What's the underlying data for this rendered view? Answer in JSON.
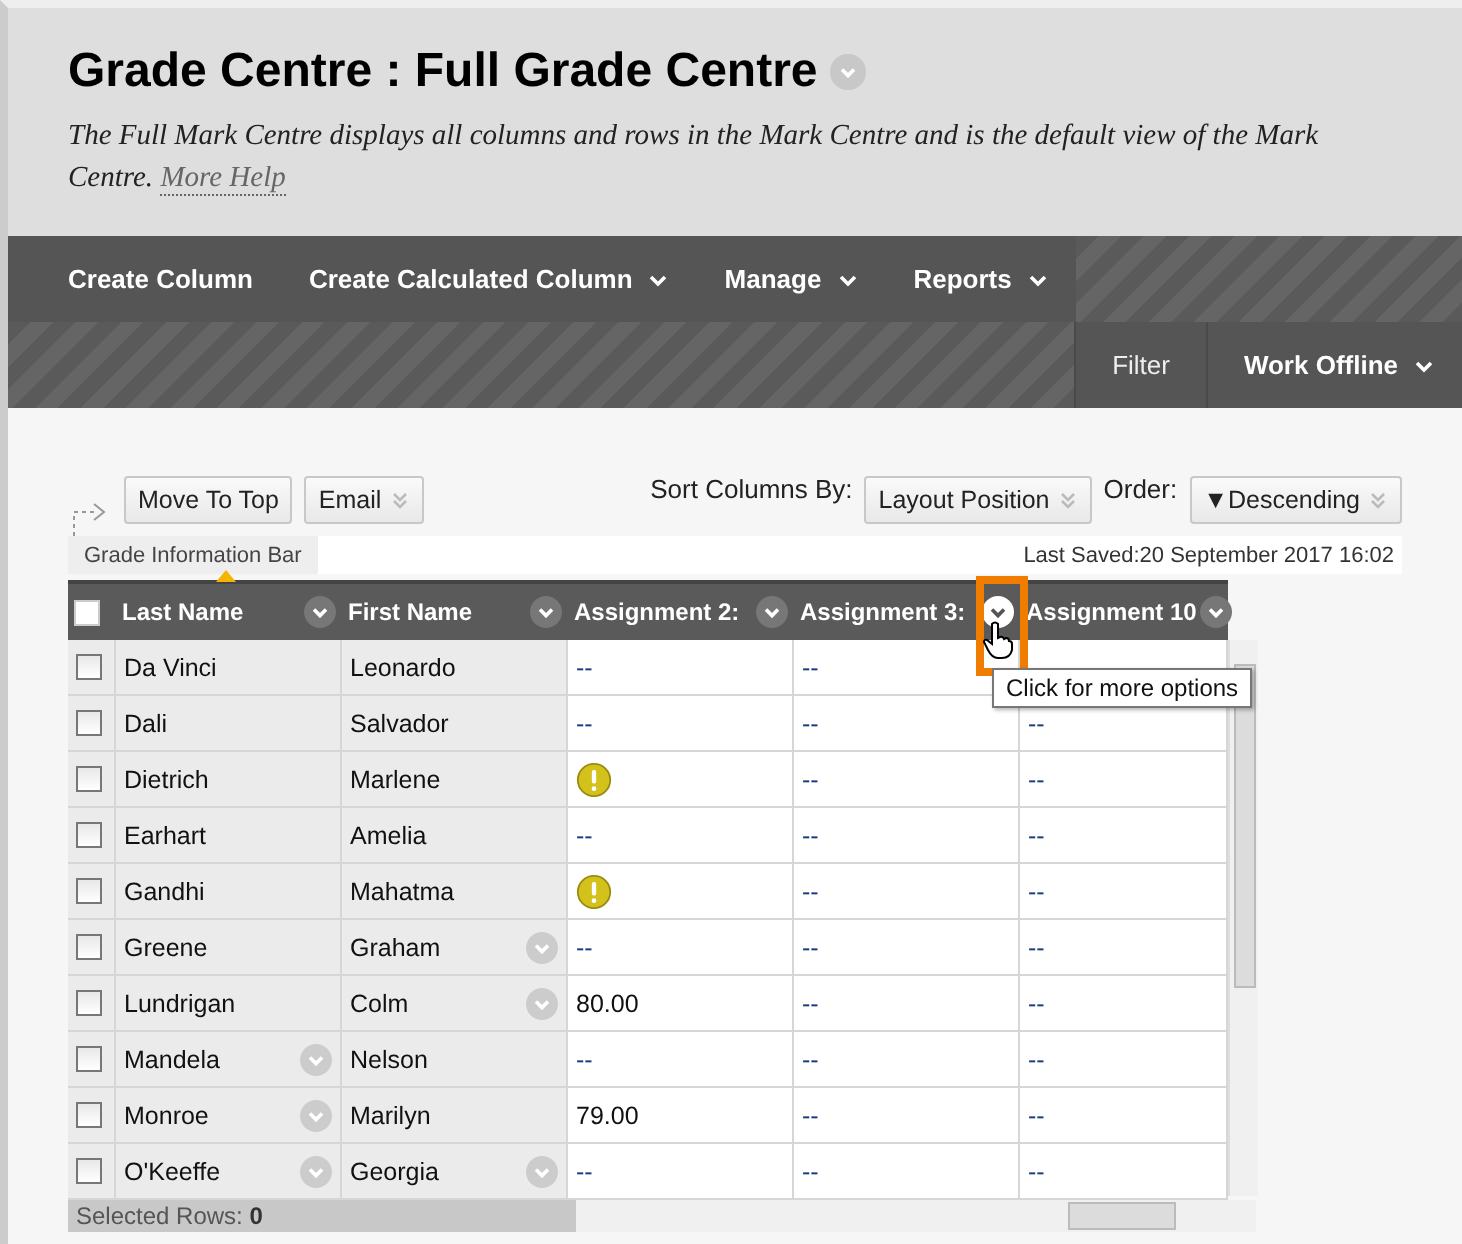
{
  "page": {
    "title": "Grade Centre : Full Grade Centre",
    "description": "The Full Mark Centre displays all columns and rows in the Mark Centre and is the default view of the Mark Centre.",
    "help_link": "More Help"
  },
  "action_bar": [
    {
      "label": "Create Column",
      "has_menu": false
    },
    {
      "label": "Create Calculated Column",
      "has_menu": true
    },
    {
      "label": "Manage",
      "has_menu": true
    },
    {
      "label": "Reports",
      "has_menu": true
    }
  ],
  "secondary_bar": [
    {
      "label": "Filter",
      "has_menu": false
    },
    {
      "label": "Work Offline",
      "has_menu": true
    }
  ],
  "controls": {
    "move_to_top": "Move To Top",
    "email": "Email",
    "sort_label": "Sort Columns By:",
    "sort_value": "Layout Position",
    "order_label": "Order:",
    "order_value": "▼Descending"
  },
  "info_bar": {
    "label": "Grade Information Bar",
    "last_saved": "Last Saved:20 September 2017 16:02"
  },
  "table": {
    "select_all_checked": false,
    "columns": [
      {
        "label": "Last Name",
        "highlighted": false
      },
      {
        "label": "First Name",
        "highlighted": false
      },
      {
        "label": "Assignment 2:",
        "highlighted": false
      },
      {
        "label": "Assignment 3:",
        "highlighted": true
      },
      {
        "label": "Assignment 10",
        "highlighted": false
      }
    ],
    "rows": [
      {
        "checked": false,
        "cells": [
          {
            "kind": "name",
            "value": "Da Vinci",
            "menu": false
          },
          {
            "kind": "name",
            "value": "Leonardo",
            "menu": false
          },
          {
            "kind": "text",
            "value": "--"
          },
          {
            "kind": "text",
            "value": "--"
          },
          {
            "kind": "blank"
          }
        ]
      },
      {
        "checked": false,
        "cells": [
          {
            "kind": "name",
            "value": "Dali",
            "menu": false
          },
          {
            "kind": "name",
            "value": "Salvador",
            "menu": false
          },
          {
            "kind": "text",
            "value": "--"
          },
          {
            "kind": "text",
            "value": "--"
          },
          {
            "kind": "text",
            "value": "--"
          }
        ]
      },
      {
        "checked": false,
        "cells": [
          {
            "kind": "name",
            "value": "Dietrich",
            "menu": false
          },
          {
            "kind": "name",
            "value": "Marlene",
            "menu": false
          },
          {
            "kind": "alert"
          },
          {
            "kind": "text",
            "value": "--"
          },
          {
            "kind": "text",
            "value": "--"
          }
        ]
      },
      {
        "checked": false,
        "cells": [
          {
            "kind": "name",
            "value": "Earhart",
            "menu": false
          },
          {
            "kind": "name",
            "value": "Amelia",
            "menu": false
          },
          {
            "kind": "text",
            "value": "--"
          },
          {
            "kind": "text",
            "value": "--"
          },
          {
            "kind": "text",
            "value": "--"
          }
        ]
      },
      {
        "checked": false,
        "cells": [
          {
            "kind": "name",
            "value": "Gandhi",
            "menu": false
          },
          {
            "kind": "name",
            "value": "Mahatma",
            "menu": false
          },
          {
            "kind": "alert"
          },
          {
            "kind": "text",
            "value": "--"
          },
          {
            "kind": "text",
            "value": "--"
          }
        ]
      },
      {
        "checked": false,
        "cells": [
          {
            "kind": "name",
            "value": "Greene",
            "menu": false
          },
          {
            "kind": "name",
            "value": "Graham",
            "menu": true
          },
          {
            "kind": "text",
            "value": "--"
          },
          {
            "kind": "text",
            "value": "--"
          },
          {
            "kind": "text",
            "value": "--"
          }
        ]
      },
      {
        "checked": false,
        "cells": [
          {
            "kind": "name",
            "value": "Lundrigan",
            "menu": false
          },
          {
            "kind": "name",
            "value": "Colm",
            "menu": true
          },
          {
            "kind": "text",
            "value": "80.00"
          },
          {
            "kind": "text",
            "value": "--"
          },
          {
            "kind": "text",
            "value": "--"
          }
        ]
      },
      {
        "checked": false,
        "cells": [
          {
            "kind": "name",
            "value": "Mandela",
            "menu": true
          },
          {
            "kind": "name",
            "value": "Nelson",
            "menu": false
          },
          {
            "kind": "text",
            "value": "--"
          },
          {
            "kind": "text",
            "value": "--"
          },
          {
            "kind": "text",
            "value": "--"
          }
        ]
      },
      {
        "checked": false,
        "cells": [
          {
            "kind": "name",
            "value": "Monroe",
            "menu": true
          },
          {
            "kind": "name",
            "value": "Marilyn",
            "menu": false
          },
          {
            "kind": "text",
            "value": "79.00"
          },
          {
            "kind": "text",
            "value": "--"
          },
          {
            "kind": "text",
            "value": "--"
          }
        ]
      },
      {
        "checked": false,
        "cells": [
          {
            "kind": "name",
            "value": "O'Keeffe",
            "menu": true
          },
          {
            "kind": "name",
            "value": "Georgia",
            "menu": true
          },
          {
            "kind": "text",
            "value": "--"
          },
          {
            "kind": "text",
            "value": "--"
          },
          {
            "kind": "text",
            "value": "--"
          }
        ]
      }
    ],
    "footer": {
      "label": "Selected Rows:",
      "count": "0"
    }
  },
  "tooltip": "Click for more options"
}
